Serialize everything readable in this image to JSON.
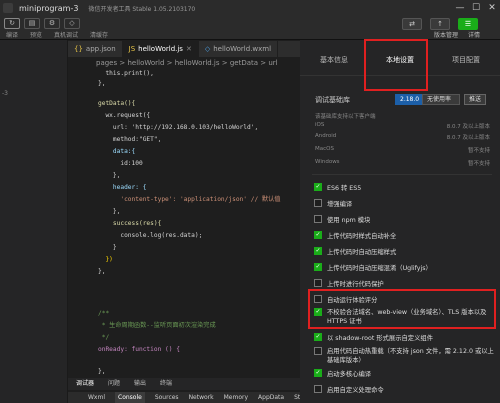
{
  "titlebar": {
    "project": "miniprogram-3",
    "tool_title": "微信开发者工具 Stable 1.05.2103170",
    "win_min": "—",
    "win_max": "☐",
    "win_close": "✕"
  },
  "toolbar": {
    "left_labels": [
      "编译",
      "预览",
      "真机调试",
      "清缓存"
    ],
    "right_labels": [
      "版本管理",
      "详情"
    ],
    "upload_btn": "↑",
    "detail_btn": "☰"
  },
  "sidebar": {
    "rows": [
      "-3"
    ]
  },
  "editor": {
    "tabs": [
      {
        "label": "app.json",
        "active": false
      },
      {
        "label": "helloWorld.js",
        "active": true
      },
      {
        "label": "helloWorld.wxml",
        "active": false
      }
    ],
    "breadcrumb": "pages > helloWorld > helloWorld.js > getData > url",
    "lines": [
      {
        "n": "",
        "t": "  this.print(),"
      },
      {
        "n": "",
        "t": "},"
      },
      {
        "n": "",
        "t": ""
      },
      {
        "n": "",
        "t": "getData(){"
      },
      {
        "n": "",
        "t": "  wx.request({"
      },
      {
        "n": "",
        "t": "    url: 'http://192.168.0.103/helloWorld',"
      },
      {
        "n": "",
        "t": "    method:\"GET\","
      },
      {
        "n": "",
        "t": "    data:{"
      },
      {
        "n": "",
        "t": "      id:100"
      },
      {
        "n": "",
        "t": "    },"
      },
      {
        "n": "",
        "t": "    header: {"
      },
      {
        "n": "",
        "t": "      'content-type': 'application/json' // 默认值"
      },
      {
        "n": "",
        "t": "    },"
      },
      {
        "n": "",
        "t": "    success(res){"
      },
      {
        "n": "",
        "t": "      console.log(res.data);"
      },
      {
        "n": "",
        "t": "    }"
      },
      {
        "n": "",
        "t": "  })"
      },
      {
        "n": "",
        "t": "},"
      },
      {
        "n": "",
        "t": ""
      },
      {
        "n": "",
        "t": ""
      },
      {
        "n": "",
        "t": ""
      },
      {
        "n": "",
        "t": ""
      },
      {
        "n": "",
        "t": "/**"
      },
      {
        "n": "",
        "t": " * 生命周期函数--监听页面初次渲染完成"
      },
      {
        "n": "",
        "t": " */"
      },
      {
        "n": "",
        "t": "onReady: function () {"
      },
      {
        "n": "",
        "t": ""
      },
      {
        "n": "",
        "t": "},"
      }
    ]
  },
  "debugger": {
    "tabs": [
      "调试器",
      "问题",
      "输出",
      "终端"
    ],
    "subtabs": [
      "Wxml",
      "Console",
      "Sources",
      "Network",
      "Memory",
      "AppData",
      "Stora"
    ]
  },
  "right_panel": {
    "tabs": [
      "基本信息",
      "本地设置",
      "项目配置"
    ],
    "sdk_label": "调试基础库",
    "sdk_version": "2.18.0",
    "sdk_usage": "无使用率",
    "push_btn": "推送",
    "support_note": "该基础库支持以下客户端",
    "compat": [
      {
        "os": "iOS",
        "ver": "8.0.7 及以上版本"
      },
      {
        "os": "Android",
        "ver": "8.0.7 及以上版本"
      },
      {
        "os": "MacOS",
        "ver": "暂不支持"
      },
      {
        "os": "Windows",
        "ver": "暂不支持"
      }
    ],
    "options": [
      {
        "label": "ES6 转 ES5",
        "checked": true
      },
      {
        "label": "增强编译",
        "checked": false
      },
      {
        "label": "使用 npm 模块",
        "checked": false
      },
      {
        "label": "上传代码时样式自动补全",
        "checked": true
      },
      {
        "label": "上传代码时自动压缩样式",
        "checked": true
      },
      {
        "label": "上传代码时自动压缩混淆（Uglifyjs）",
        "checked": true
      },
      {
        "label": "上传时进行代码保护",
        "checked": false
      },
      {
        "label": "自动运行体验评分",
        "checked": false
      },
      {
        "label": "不校验合法域名、web-view（业务域名）、TLS 版本以及 HTTPS 证书",
        "checked": true
      },
      {
        "label": "以 shadow-root 形式展示自定义组件",
        "checked": true
      },
      {
        "label": "启用代码自动热重载（不支持 json 文件，需 2.12.0 或以上基础库版本）",
        "checked": false
      },
      {
        "label": "启动多核心编译",
        "checked": true
      },
      {
        "label": "启用自定义处理命令",
        "checked": false
      }
    ]
  },
  "colors": {
    "accent_green": "#1aad19",
    "highlight_red": "#e02020",
    "sdk_blue": "#1c5fa8"
  }
}
